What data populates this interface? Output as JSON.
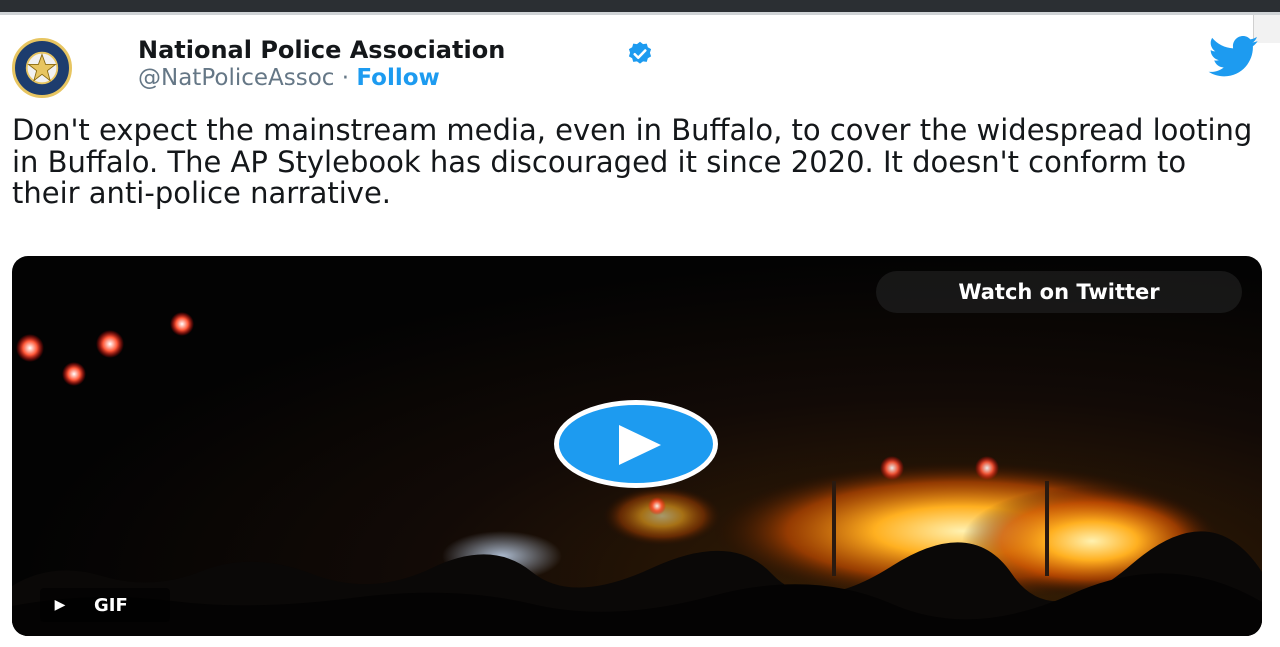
{
  "tweet": {
    "author_name": "National Police Association",
    "handle": "@NatPoliceAssoc",
    "separator": "·",
    "follow_label": "Follow",
    "text": "Don't expect the mainstream media, even in Buffalo, to cover the widespread looting in Buffalo. The AP Stylebook has discouraged it since 2020. It doesn't conform to their anti-police narrative.",
    "verified": true
  },
  "media": {
    "watch_label": "Watch on Twitter",
    "gif_label": "GIF"
  },
  "icons": {
    "logo": "twitter-bird-icon",
    "verified": "verified-badge-icon",
    "play": "play-icon"
  },
  "colors": {
    "accent": "#1d9bf0",
    "text": "#14171a",
    "secondary": "#657786"
  }
}
